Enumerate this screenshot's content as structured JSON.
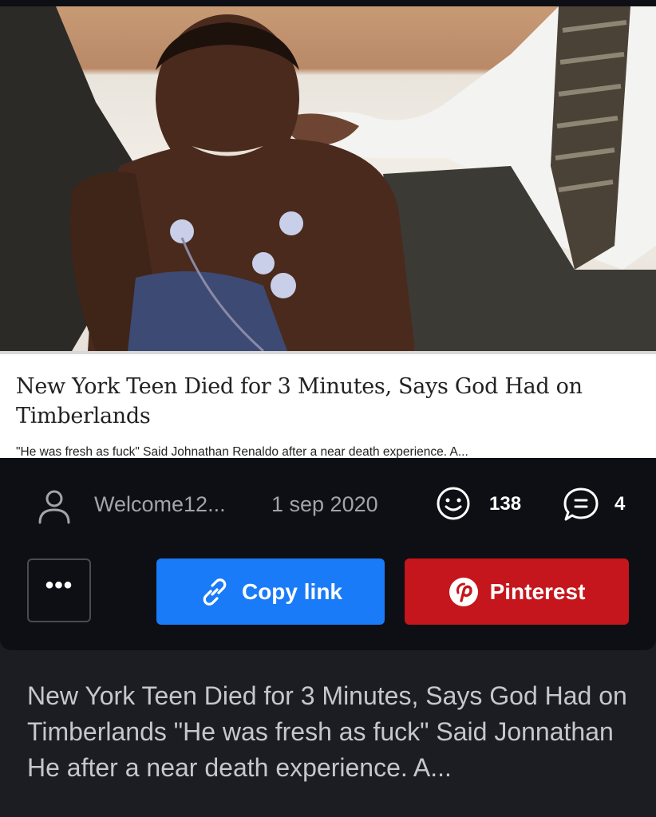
{
  "meme": {
    "caption_title": "New York Teen Died for 3 Minutes, Says God Had on Timberlands",
    "caption_subtitle": "\"He was fresh as fuck\" Said Johnathan Renaldo after a near death experience. A..."
  },
  "meta": {
    "author": "Welcome12...",
    "date": "1 sep 2020",
    "reactions_count": "138",
    "comments_count": "4",
    "icons": [
      "user-icon",
      "smile-icon",
      "comment-icon"
    ]
  },
  "actions": {
    "more_label": "•••",
    "copy_label": "Copy link",
    "pinterest_label": "Pinterest",
    "icons": [
      "link-icon",
      "pinterest-icon"
    ]
  },
  "description": "New York Teen Died for 3 Minutes, Says God Had on Timberlands \"He was fresh as fuck\" Said Jonnathan He after a near death experience. A...",
  "colors": {
    "page_bg": "#1c1d22",
    "card_bg": "#0e0f14",
    "copy_button": "#1a7bf8",
    "pinterest_button": "#c4161c",
    "meta_text": "#a3a4ab",
    "description_text": "#c6c7cc"
  }
}
